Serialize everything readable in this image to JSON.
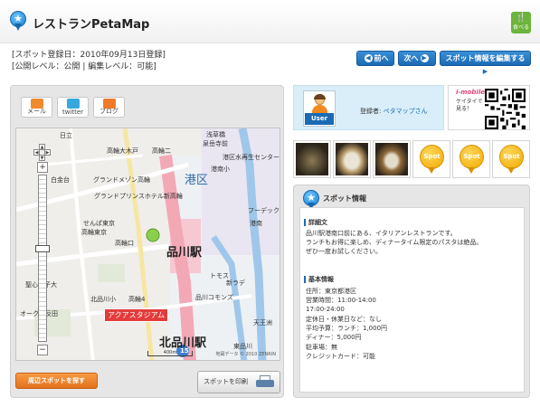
{
  "header": {
    "app_title": "レストランPetaMap",
    "badge_label": "食べる"
  },
  "meta": {
    "registered": "[スポット登録日：2010年09月13日登録]",
    "levels": "[公開レベル：公開 | 編集レベル：可能]"
  },
  "nav": {
    "prev": "前へ",
    "next": "次へ",
    "edit": "スポット情報を編集する"
  },
  "share": [
    {
      "label": "メール",
      "color": "#f18a2c"
    },
    {
      "label": "twitter",
      "color": "#38a9df"
    },
    {
      "label": "ブログ",
      "color": "#f07a2a"
    }
  ],
  "map": {
    "labels": [
      "日立",
      "浅草橋",
      "泉岳寺前",
      "高輪大木戸",
      "高輪二",
      "港区",
      "港南小",
      "港区水再生センター",
      "グランドメゾン高輪",
      "グランドプリンスホテル新高輪",
      "白金台",
      "せんぱ東京",
      "高輪東京",
      "高輪口",
      "品川駅",
      "聖心女子大",
      "アクアスタジアム",
      "トモス",
      "北品川小",
      "北品川駅",
      "高輪4",
      "フーデックス",
      "新ラデ",
      "品川コモンズ",
      "港南",
      "天王洲",
      "東品川",
      "オーク五反田"
    ],
    "tag": "アクアスタジアム",
    "route": "15",
    "scale_label": "400m",
    "copyright": "地図データ © 2010 ZENRIN"
  },
  "actions": {
    "nearby": "周辺スポットを探す",
    "print": "スポットを印刷"
  },
  "user": {
    "avatar_label": "User",
    "registrant_label": "登録者:",
    "registrant_name": "ペタマップさん"
  },
  "mobile": {
    "logo": "i-mobile",
    "text_1": "ケイタイで",
    "text_2": "見る！"
  },
  "photos": {
    "spot_label": "Spot"
  },
  "info": {
    "title": "スポット情報",
    "detail_heading": "詳細文",
    "detail_lines": [
      "品川駅港南口前にある、イタリアンレストランです。",
      "ランチもお得に楽しめ、ディナータイム限定のパスタは絶品。",
      "ぜひ一度お試しください。"
    ],
    "basic_heading": "基本情報",
    "basic_lines": [
      "住所：東京都港区",
      "営業時間：11:00-14:00",
      "17:00-24:00",
      "定休日・休業日など：なし",
      "平均予算：ランチ：1,000円",
      "ディナー：5,000円",
      "駐車場：無",
      "クレジットカード：可能"
    ]
  }
}
